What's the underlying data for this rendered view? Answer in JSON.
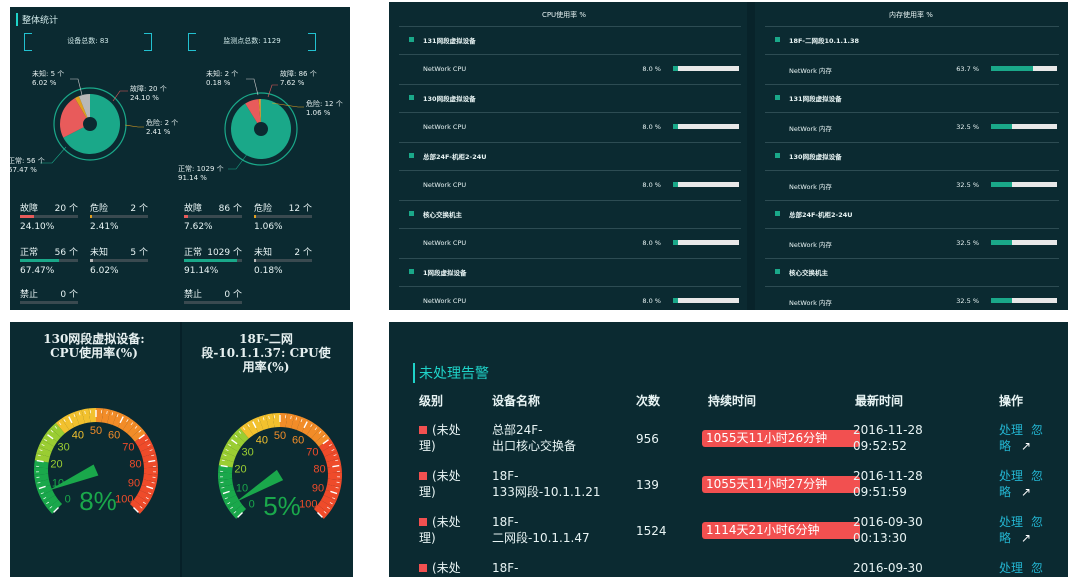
{
  "overview": {
    "title": "整体统计",
    "left": {
      "total_label": "设备总数: 83",
      "pie_labels": {
        "unknown": [
          "未知: 5 个",
          "6.02 %"
        ],
        "fault": [
          "故障: 20 个",
          "24.10 %"
        ],
        "danger": [
          "危险: 2 个",
          "2.41 %"
        ],
        "normal": [
          "正常: 56 个",
          "67.47 %"
        ]
      },
      "slices": [
        {
          "name": "normal",
          "value": 67.47,
          "color": "#1aa889"
        },
        {
          "name": "fault",
          "value": 24.1,
          "color": "#e85b5b"
        },
        {
          "name": "danger",
          "value": 2.41,
          "color": "#e0a020"
        },
        {
          "name": "unknown",
          "value": 6.02,
          "color": "#b8b8b8"
        }
      ],
      "stats": [
        {
          "label": "故障",
          "count": "20 个",
          "pct": "24.10%",
          "fill": 0.241,
          "color": "#e85b5b"
        },
        {
          "label": "危险",
          "count": "2 个",
          "pct": "2.41%",
          "fill": 0.0241,
          "color": "#e0a020"
        },
        {
          "label": "正常",
          "count": "56 个",
          "pct": "67.47%",
          "fill": 0.6747,
          "color": "#1aa889"
        },
        {
          "label": "未知",
          "count": "5 个",
          "pct": "6.02%",
          "fill": 0.0602,
          "color": "#b8b8b8"
        },
        {
          "label": "禁止",
          "count": "0 个",
          "pct": "",
          "fill": 0,
          "color": "#888888"
        }
      ]
    },
    "right": {
      "total_label": "监测点总数: 1129",
      "pie_labels": {
        "unknown": [
          "未知: 2 个",
          "0.18 %"
        ],
        "fault": [
          "故障: 86 个",
          "7.62 %"
        ],
        "danger": [
          "危险: 12 个",
          "1.06 %"
        ],
        "normal": [
          "正常: 1029 个",
          "91.14 %"
        ]
      },
      "slices": [
        {
          "name": "normal",
          "value": 91.14,
          "color": "#1aa889"
        },
        {
          "name": "fault",
          "value": 7.62,
          "color": "#e85b5b"
        },
        {
          "name": "danger",
          "value": 1.06,
          "color": "#e0a020"
        },
        {
          "name": "unknown",
          "value": 0.18,
          "color": "#b8b8b8"
        }
      ],
      "stats": [
        {
          "label": "故障",
          "count": "86 个",
          "pct": "7.62%",
          "fill": 0.0762,
          "color": "#e85b5b"
        },
        {
          "label": "危险",
          "count": "12 个",
          "pct": "1.06%",
          "fill": 0.0106,
          "color": "#e0a020"
        },
        {
          "label": "正常",
          "count": "1029 个",
          "pct": "91.14%",
          "fill": 0.9114,
          "color": "#1aa889"
        },
        {
          "label": "未知",
          "count": "2 个",
          "pct": "0.18%",
          "fill": 0.0018,
          "color": "#b8b8b8"
        },
        {
          "label": "禁止",
          "count": "0 个",
          "pct": "",
          "fill": 0,
          "color": "#888888"
        }
      ]
    }
  },
  "usage": {
    "cpu_header": "CPU使用率 %",
    "mem_header": "内存使用率 %",
    "cpu_rows": [
      {
        "device": "131网段虚拟设备",
        "metric": "NetWork CPU",
        "value": "8.0 %",
        "fill": 0.08
      },
      {
        "device": "130网段虚拟设备",
        "metric": "NetWork CPU",
        "value": "8.0 %",
        "fill": 0.08
      },
      {
        "device": "总部24F-机柜2-24U",
        "metric": "NetWork CPU",
        "value": "8.0 %",
        "fill": 0.08
      },
      {
        "device": "核心交换机主",
        "metric": "NetWork CPU",
        "value": "8.0 %",
        "fill": 0.08
      },
      {
        "device": "1网段虚拟设备",
        "metric": "NetWork CPU",
        "value": "8.0 %",
        "fill": 0.08
      }
    ],
    "mem_rows": [
      {
        "device": "18F-二网段10.1.1.38",
        "metric": "NetWork 内存",
        "value": "63.7 %",
        "fill": 0.637
      },
      {
        "device": "131网段虚拟设备",
        "metric": "NetWork 内存",
        "value": "32.5 %",
        "fill": 0.325
      },
      {
        "device": "130网段虚拟设备",
        "metric": "NetWork 内存",
        "value": "32.5 %",
        "fill": 0.325
      },
      {
        "device": "总部24F-机柜2-24U",
        "metric": "NetWork 内存",
        "value": "32.5 %",
        "fill": 0.325
      },
      {
        "device": "核心交换机主",
        "metric": "NetWork 内存",
        "value": "32.5 %",
        "fill": 0.325
      }
    ]
  },
  "gauges": [
    {
      "title_lines": [
        "130网段虚拟设备:",
        "CPU使用率(%)"
      ],
      "value": 8,
      "value_label": "8%",
      "ticks": [
        "0",
        "10",
        "20",
        "30",
        "40",
        "50",
        "60",
        "70",
        "80",
        "90",
        "100"
      ]
    },
    {
      "title_lines": [
        "18F-二网",
        "段-10.1.1.37: CPU使",
        "用率(%)"
      ],
      "value": 5,
      "value_label": "5%",
      "ticks": [
        "0",
        "10",
        "20",
        "30",
        "40",
        "50",
        "60",
        "70",
        "80",
        "90",
        "100"
      ]
    }
  ],
  "alarms": {
    "title": "未处理告警",
    "headers": [
      "级别",
      "设备名称",
      "次数",
      "持续时间",
      "最新时间",
      "操作"
    ],
    "rows": [
      {
        "level": [
          "(未处",
          "理)"
        ],
        "device": [
          "总部24F-",
          "出口核心交换备"
        ],
        "count": "956",
        "duration": "1055天11小时26分钟",
        "time": [
          "2016-11-28",
          "09:52:52"
        ],
        "op1": "处理",
        "op2": [
          "忽",
          "略"
        ]
      },
      {
        "level": [
          "(未处",
          "理)"
        ],
        "device": [
          "18F-",
          "133网段-10.1.1.21"
        ],
        "count": "139",
        "duration": "1055天11小时27分钟",
        "time": [
          "2016-11-28",
          "09:51:59"
        ],
        "op1": "处理",
        "op2": [
          "忽",
          "略"
        ]
      },
      {
        "level": [
          "(未处",
          "理)"
        ],
        "device": [
          "18F-",
          "二网段-10.1.1.47"
        ],
        "count": "1524",
        "duration": "1114天21小时6分钟",
        "time": [
          "2016-09-30",
          "00:13:30"
        ],
        "op1": "处理",
        "op2": [
          "忽",
          "略"
        ]
      },
      {
        "level": [
          "(未处",
          ""
        ],
        "device": [
          "18F-",
          ""
        ],
        "count": "",
        "duration": "",
        "time": [
          "2016-09-30",
          ""
        ],
        "op1": "处理",
        "op2": [
          "忽",
          ""
        ]
      }
    ]
  }
}
